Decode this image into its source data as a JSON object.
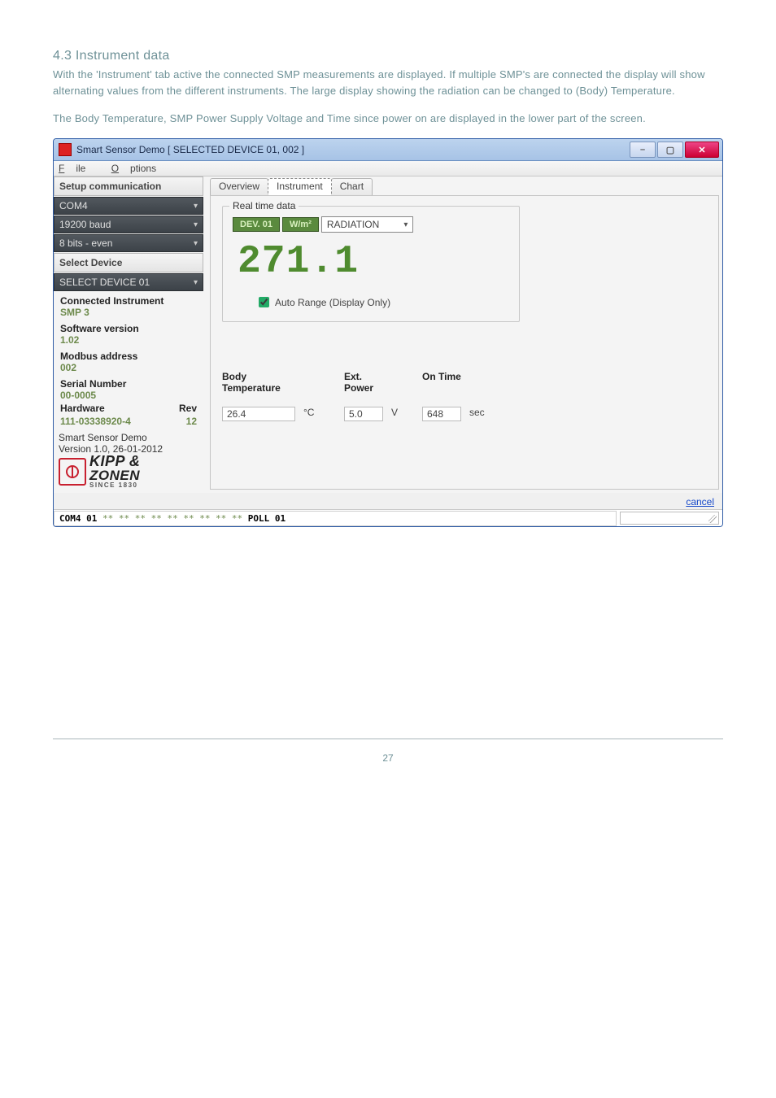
{
  "doc": {
    "heading": "4.3 Instrument data",
    "para1": "With the 'Instrument' tab active the connected SMP measurements are displayed. If multiple SMP's are connected the display will show alternating values from the different instruments. The large display showing the radiation can be changed to (Body) Temperature.",
    "para2": "The Body Temperature, SMP Power Supply Voltage and Time since power on are displayed in the lower part of the screen.",
    "page_number": "27"
  },
  "window": {
    "title": "Smart Sensor Demo [ SELECTED DEVICE 01, 002 ]",
    "menu": {
      "file": "File",
      "options": "Options"
    },
    "controls": {
      "min": "–",
      "max": "▢",
      "close": "✕"
    }
  },
  "sidebar": {
    "setup_label": "Setup communication",
    "com_port": "COM4",
    "baud": "19200 baud",
    "parity": "8 bits - even",
    "select_device_label": "Select Device",
    "select_device": "SELECT DEVICE 01",
    "connected_label": "Connected Instrument",
    "connected_value": "SMP 3",
    "sw_label": "Software version",
    "sw_value": "1.02",
    "modbus_label": "Modbus address",
    "modbus_value": "002",
    "serial_label": "Serial Number",
    "serial_value": "00-0005",
    "hw_label": "Hardware",
    "rev_label": "Rev",
    "hw_value": "111-03338920-4",
    "rev_value": "12",
    "app_name": "Smart Sensor Demo",
    "app_version": "Version 1.0, 26-01-2012",
    "brand_l1": "KIPP &",
    "brand_l2": "ZONEN",
    "brand_l3": "SINCE 1830"
  },
  "tabs": {
    "overview": "Overview",
    "instrument": "Instrument",
    "chart": "Chart"
  },
  "realtime": {
    "legend": "Real time data",
    "dev": "DEV. 01",
    "unit": "W/m²",
    "quantity": "RADIATION",
    "reading": "271.1",
    "auto_range": "Auto Range (Display Only)"
  },
  "readings": {
    "body_temp_label": "Body Temperature",
    "ext_power_label": "Ext. Power",
    "on_time_label": "On Time",
    "body_temp_val": "26.4",
    "body_temp_unit": "°C",
    "ext_power_val": "5.0",
    "ext_power_unit": "V",
    "on_time_val": "648",
    "on_time_unit": "sec"
  },
  "footer": {
    "cancel": "cancel",
    "status_prefix": "COM4  01 ",
    "status_stars": "** ** ** ** ** ** ** ** **",
    "status_suffix": " POLL 01"
  }
}
